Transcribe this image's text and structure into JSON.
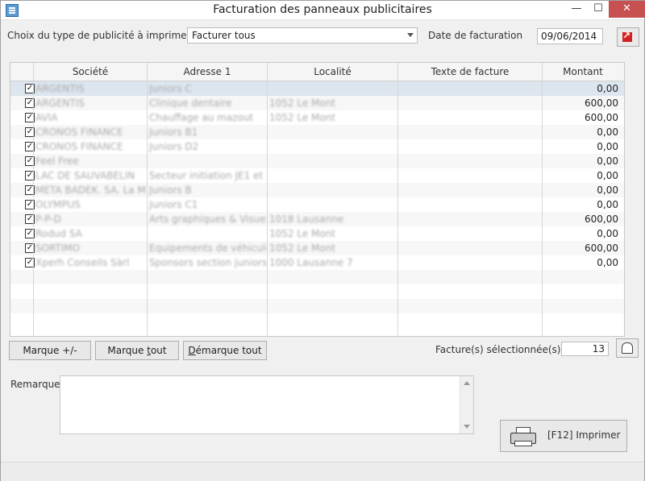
{
  "window": {
    "title": "Facturation des panneaux publicitaires"
  },
  "form": {
    "type_label": "Choix du type de publicité à imprimer",
    "type_value": "Facturer tous",
    "date_label": "Date de facturation",
    "date_value": "09/06/2014"
  },
  "table": {
    "columns": [
      "Société",
      "Adresse 1",
      "Localité",
      "Texte de facture",
      "Montant"
    ],
    "rows": [
      {
        "checked": true,
        "societe": "ARGENTIS",
        "adresse": "Juniors C",
        "localite": "",
        "texte": "",
        "montant": "0,00"
      },
      {
        "checked": true,
        "societe": "ARGENTIS",
        "adresse": "Clinique dentaire",
        "localite": "1052 Le Mont",
        "texte": "",
        "montant": "600,00"
      },
      {
        "checked": true,
        "societe": "AVIA",
        "adresse": "Chauffage au mazout",
        "localite": "1052 Le Mont",
        "texte": "",
        "montant": "600,00"
      },
      {
        "checked": true,
        "societe": "CRONOS FINANCE",
        "adresse": "Juniors B1",
        "localite": "",
        "texte": "",
        "montant": "0,00"
      },
      {
        "checked": true,
        "societe": "CRONOS FINANCE",
        "adresse": "Juniors D2",
        "localite": "",
        "texte": "",
        "montant": "0,00"
      },
      {
        "checked": true,
        "societe": "Feel Free",
        "adresse": "",
        "localite": "",
        "texte": "",
        "montant": "0,00"
      },
      {
        "checked": true,
        "societe": "LAC DE SAUVABELIN",
        "adresse": "Secteur initiation JE1 et",
        "localite": "",
        "texte": "",
        "montant": "0,00"
      },
      {
        "checked": true,
        "societe": "META BADEK. SA. La M",
        "adresse": "Juniors B",
        "localite": "",
        "texte": "",
        "montant": "0,00"
      },
      {
        "checked": true,
        "societe": "OLYMPUS",
        "adresse": "Juniors C1",
        "localite": "",
        "texte": "",
        "montant": "0,00"
      },
      {
        "checked": true,
        "societe": "P-P-D",
        "adresse": "Arts graphiques & Visuel",
        "localite": "1018 Lausanne",
        "texte": "",
        "montant": "600,00"
      },
      {
        "checked": true,
        "societe": "Rodud SA",
        "adresse": "",
        "localite": "1052 Le Mont",
        "texte": "",
        "montant": "0,00"
      },
      {
        "checked": true,
        "societe": "SORTIMO",
        "adresse": "Equipements de véhicule",
        "localite": "1052 Le Mont",
        "texte": "",
        "montant": "600,00"
      },
      {
        "checked": true,
        "societe": "Xperh Conseils Sàrl",
        "adresse": "Sponsors section juniors",
        "localite": "1000 Lausanne 7",
        "texte": "",
        "montant": "0,00"
      }
    ]
  },
  "buttons": {
    "mark_toggle_pre": "Marque +/-",
    "mark_all_pre": "Marque ",
    "mark_all_u": "t",
    "mark_all_post": "out",
    "unmark_all_u": "D",
    "unmark_all_post": "émarque tout",
    "print": "[F12] Imprimer"
  },
  "selection": {
    "label": "Facture(s) sélectionnée(s)",
    "count": "13"
  },
  "remarque": {
    "label": "Remarque",
    "value": ""
  },
  "icons": {
    "export": "external-link-icon",
    "calc": "calculator-icon",
    "print": "printer-icon"
  }
}
